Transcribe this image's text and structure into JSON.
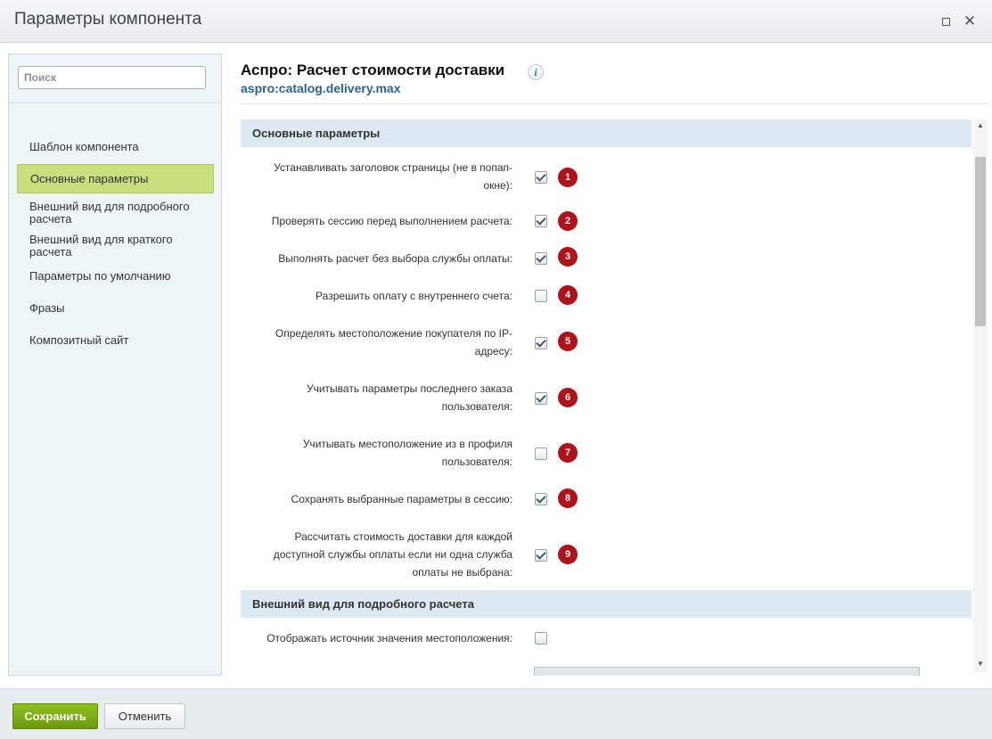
{
  "window": {
    "title": "Параметры компонента",
    "maximize_icon": "maximize-icon",
    "close_icon": "close-icon",
    "close_glyph": "✕"
  },
  "sidebar": {
    "search_placeholder": "Поиск",
    "items": [
      {
        "label": "Шаблон компонента",
        "active": false
      },
      {
        "label": "Основные параметры",
        "active": true
      },
      {
        "label": "Внешний вид для подробного расчета",
        "active": false
      },
      {
        "label": "Внешний вид для краткого расчета",
        "active": false
      },
      {
        "label": "Параметры по умолчанию",
        "active": false
      },
      {
        "label": "Фразы",
        "active": false
      },
      {
        "label": "Композитный сайт",
        "active": false
      }
    ]
  },
  "component": {
    "title": "Аспро: Расчет стоимости доставки",
    "code": "aspro:catalog.delivery.max",
    "info_glyph": "i"
  },
  "sections": [
    {
      "title": "Основные параметры",
      "params": [
        {
          "label": "Устанавливать заголовок страницы (не в попап-окне):",
          "checked": true,
          "badge": "1"
        },
        {
          "label": "Проверять сессию перед выполнением расчета:",
          "checked": true,
          "badge": "2"
        },
        {
          "label": "Выполнять расчет без выбора службы оплаты:",
          "checked": true,
          "badge": "3"
        },
        {
          "label": "Разрешить оплату с внутреннего счета:",
          "checked": false,
          "badge": "4"
        },
        {
          "label": "Определять местоположение покупателя по IP-адресу:",
          "checked": true,
          "badge": "5"
        },
        {
          "label": "Учитывать параметры последнего заказа пользователя:",
          "checked": true,
          "badge": "6"
        },
        {
          "label": "Учитывать местоположение из в профиля пользователя:",
          "checked": false,
          "badge": "7"
        },
        {
          "label": "Сохранять выбранные параметры в сессию:",
          "checked": true,
          "badge": "8"
        },
        {
          "label": "Рассчитать стоимость доставки для каждой доступной службы оплаты если ни одна служба оплаты не выбрана:",
          "checked": true,
          "badge": "9"
        }
      ]
    },
    {
      "title": "Внешний вид для подробного расчета",
      "params": [
        {
          "label": "Отображать источник значения местоположения:",
          "checked": false
        }
      ]
    }
  ],
  "scrollbar": {
    "up_glyph": "▲",
    "down_glyph": "▼"
  },
  "footer": {
    "save_label": "Сохранить",
    "cancel_label": "Отменить"
  },
  "colors": {
    "badge": "#b1121a",
    "active_nav": "#c9df7e",
    "save_button": "#7bab12",
    "section_header": "#dde9f2",
    "link": "#2a6496"
  }
}
